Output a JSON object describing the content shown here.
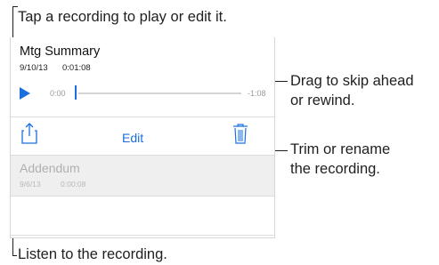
{
  "callouts": {
    "tap": "Tap a recording to play or edit it.",
    "drag_1": "Drag to skip ahead",
    "drag_2": "or rewind.",
    "trim_1": "Trim or rename",
    "trim_2": "the recording.",
    "listen": "Listen to the recording."
  },
  "recording": {
    "title": "Mtg Summary",
    "date": "9/10/13",
    "duration": "0:01:08",
    "elapsed": "0:00",
    "remaining": "-1:08",
    "progress_fraction": 0.0
  },
  "actions": {
    "edit_label": "Edit",
    "share_icon": "share-icon",
    "trash_icon": "trash-icon"
  },
  "list": {
    "item_title": "Addendum",
    "item_date": "9/6/13",
    "item_duration": "0:00:08"
  },
  "colors": {
    "accent": "#1a6fe0"
  }
}
